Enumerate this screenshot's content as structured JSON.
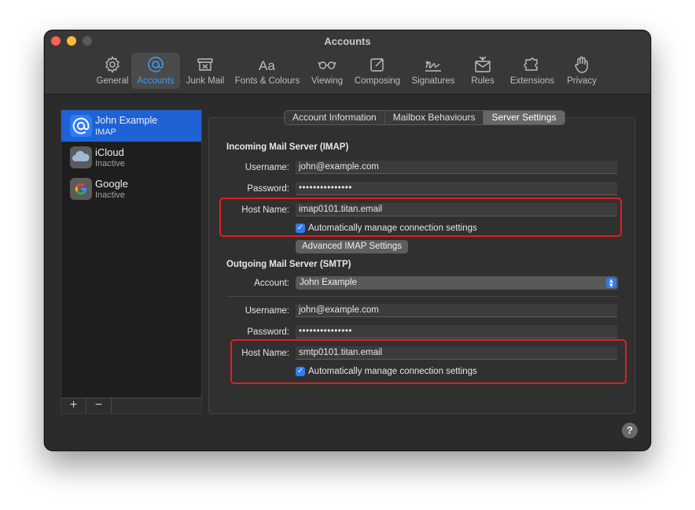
{
  "window": {
    "title": "Accounts"
  },
  "toolbar": {
    "items": [
      {
        "label": "General",
        "icon": "gear-icon"
      },
      {
        "label": "Accounts",
        "icon": "at-icon",
        "active": true
      },
      {
        "label": "Junk Mail",
        "icon": "junk-mail-icon"
      },
      {
        "label": "Fonts & Colours",
        "icon": "fonts-icon"
      },
      {
        "label": "Viewing",
        "icon": "glasses-icon"
      },
      {
        "label": "Composing",
        "icon": "compose-icon"
      },
      {
        "label": "Signatures",
        "icon": "signature-icon"
      },
      {
        "label": "Rules",
        "icon": "rules-icon"
      },
      {
        "label": "Extensions",
        "icon": "puzzle-icon"
      },
      {
        "label": "Privacy",
        "icon": "hand-icon"
      }
    ]
  },
  "sidebar": {
    "accounts": [
      {
        "name": "John Example",
        "type": "IMAP",
        "icon": "at-icon",
        "selected": true
      },
      {
        "name": "iCloud",
        "type": "Inactive",
        "icon": "icloud-icon"
      },
      {
        "name": "Google",
        "type": "Inactive",
        "icon": "google-icon"
      }
    ],
    "add_label": "+",
    "remove_label": "−"
  },
  "tabs": [
    {
      "label": "Account Information"
    },
    {
      "label": "Mailbox Behaviours"
    },
    {
      "label": "Server Settings",
      "active": true
    }
  ],
  "incoming": {
    "title": "Incoming Mail Server (IMAP)",
    "username_label": "Username:",
    "username": "john@example.com",
    "password_label": "Password:",
    "password": "•••••••••••••••",
    "hostname_label": "Host Name:",
    "hostname": "imap0101.titan.email",
    "auto_manage_label": "Automatically manage connection settings",
    "advanced_button": "Advanced IMAP Settings"
  },
  "outgoing": {
    "title": "Outgoing Mail Server (SMTP)",
    "account_label": "Account:",
    "account": "John Example",
    "username_label": "Username:",
    "username": "john@example.com",
    "password_label": "Password:",
    "password": "•••••••••••••••",
    "hostname_label": "Host Name:",
    "hostname": "smtp0101.titan.email",
    "auto_manage_label": "Automatically manage connection settings"
  },
  "help_label": "?",
  "colors": {
    "accent": "#2f7cf6",
    "selected_row": "#1f62d6",
    "highlight_box": "#e02020"
  }
}
